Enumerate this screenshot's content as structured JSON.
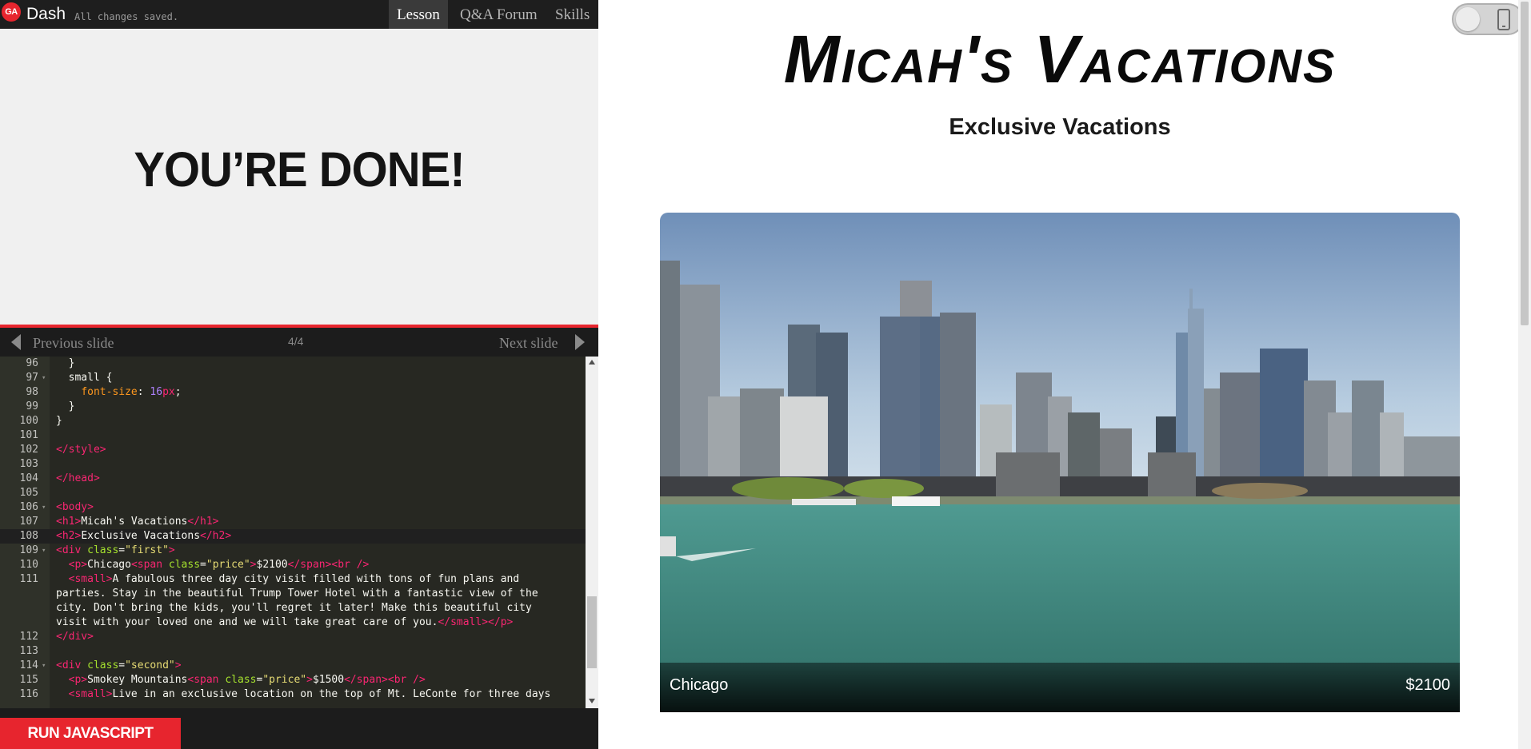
{
  "app": {
    "logo_text": "GA",
    "brand": "Dash",
    "save_status": "All changes saved.",
    "tabs": [
      {
        "label": "Lesson",
        "active": true
      },
      {
        "label": "Q&A Forum",
        "active": false
      },
      {
        "label": "Skills",
        "active": false
      }
    ]
  },
  "slide": {
    "headline": "YOU’RE DONE!",
    "prev_label": "Previous slide",
    "next_label": "Next slide",
    "counter": "4/4"
  },
  "editor": {
    "active_line": 108,
    "lines": [
      {
        "n": "96",
        "fold": false,
        "html": "  }"
      },
      {
        "n": "97",
        "fold": true,
        "html": "  small {"
      },
      {
        "n": "98",
        "fold": false,
        "html": "    <span class=\"pr\">font-size</span>: <span class=\"nm\">16</span><span class=\"tg\">px</span>;"
      },
      {
        "n": "99",
        "fold": false,
        "html": "  }"
      },
      {
        "n": "100",
        "fold": false,
        "html": "}"
      },
      {
        "n": "101",
        "fold": false,
        "html": ""
      },
      {
        "n": "102",
        "fold": false,
        "html": "<span class=\"tg\">&lt;/style&gt;</span>"
      },
      {
        "n": "103",
        "fold": false,
        "html": ""
      },
      {
        "n": "104",
        "fold": false,
        "html": "<span class=\"tg\">&lt;/head&gt;</span>"
      },
      {
        "n": "105",
        "fold": false,
        "html": ""
      },
      {
        "n": "106",
        "fold": true,
        "html": "<span class=\"tg\">&lt;body&gt;</span>"
      },
      {
        "n": "107",
        "fold": false,
        "html": "<span class=\"tg\">&lt;h1&gt;</span>Micah's Vacations<span class=\"tg\">&lt;/h1&gt;</span>"
      },
      {
        "n": "108",
        "fold": false,
        "html": "<span class=\"tg\">&lt;h2&gt;</span>Exclusive Vacations<span class=\"tg\">&lt;/h2&gt;</span>"
      },
      {
        "n": "109",
        "fold": true,
        "html": "<span class=\"tg\">&lt;div</span> <span class=\"at\">class</span>=<span class=\"st\">\"first\"</span><span class=\"tg\">&gt;</span>"
      },
      {
        "n": "110",
        "fold": false,
        "html": "  <span class=\"tg\">&lt;p&gt;</span>Chicago<span class=\"tg\">&lt;span</span> <span class=\"at\">class</span>=<span class=\"st\">\"price\"</span><span class=\"tg\">&gt;</span>$2100<span class=\"tg\">&lt;/span&gt;&lt;br /&gt;</span>"
      },
      {
        "n": "111",
        "fold": false,
        "html": "  <span class=\"tg\">&lt;small&gt;</span>A fabulous three day city visit filled with tons of fun plans and"
      },
      {
        "n": "",
        "fold": false,
        "html": "parties. Stay in the beautiful Trump Tower Hotel with a fantastic view of the"
      },
      {
        "n": "",
        "fold": false,
        "html": "city. Don't bring the kids, you'll regret it later! Make this beautiful city"
      },
      {
        "n": "",
        "fold": false,
        "html": "visit with your loved one and we will take great care of you.<span class=\"tg\">&lt;/small&gt;&lt;/p&gt;</span>"
      },
      {
        "n": "112",
        "fold": false,
        "html": "<span class=\"tg\">&lt;/div&gt;</span>"
      },
      {
        "n": "113",
        "fold": false,
        "html": ""
      },
      {
        "n": "114",
        "fold": true,
        "html": "<span class=\"tg\">&lt;div</span> <span class=\"at\">class</span>=<span class=\"st\">\"second\"</span><span class=\"tg\">&gt;</span>"
      },
      {
        "n": "115",
        "fold": false,
        "html": "  <span class=\"tg\">&lt;p&gt;</span>Smokey Mountains<span class=\"tg\">&lt;span</span> <span class=\"at\">class</span>=<span class=\"st\">\"price\"</span><span class=\"tg\">&gt;</span>$1500<span class=\"tg\">&lt;/span&gt;&lt;br /&gt;</span>"
      },
      {
        "n": "116",
        "fold": false,
        "html": "  <span class=\"tg\">&lt;small&gt;</span>Live in an exclusive location on the top of Mt. LeConte for three days"
      }
    ],
    "run_button": "RUN JAVASCRIPT"
  },
  "preview": {
    "title": "Micah's Vacations",
    "subtitle": "Exclusive Vacations",
    "card": {
      "city": "Chicago",
      "price": "$2100"
    }
  },
  "colors": {
    "accent": "#e7252e",
    "editor_bg": "#272822",
    "topbar_bg": "#1e1e1e"
  }
}
